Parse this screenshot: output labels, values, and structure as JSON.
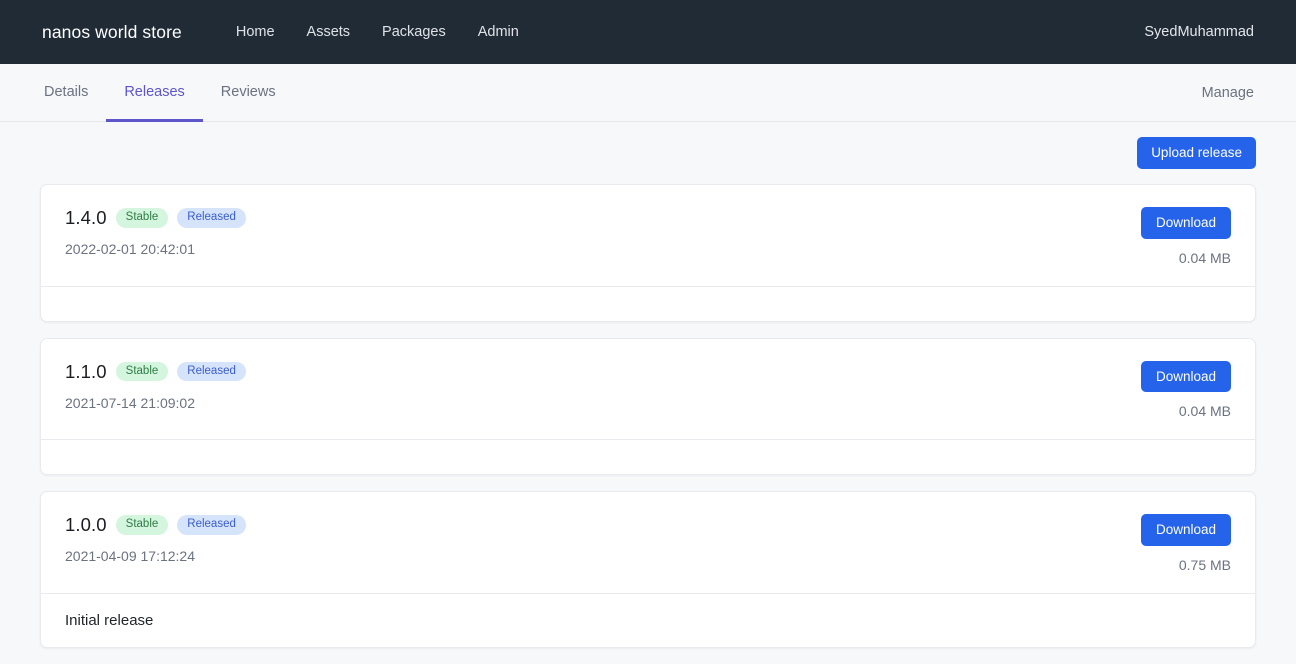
{
  "navbar": {
    "brand": "nanos world store",
    "links": [
      {
        "label": "Home"
      },
      {
        "label": "Assets"
      },
      {
        "label": "Packages"
      },
      {
        "label": "Admin"
      }
    ],
    "user": "SyedMuhammad"
  },
  "tabbar": {
    "tabs": [
      {
        "label": "Details",
        "active": false
      },
      {
        "label": "Releases",
        "active": true
      },
      {
        "label": "Reviews",
        "active": false
      }
    ],
    "manage_label": "Manage",
    "active_color": "#5d55c9"
  },
  "toolbar": {
    "upload_label": "Upload release",
    "accent_color": "#2563eb"
  },
  "releases": [
    {
      "version": "1.4.0",
      "badges": [
        {
          "label": "Stable",
          "type": "stable"
        },
        {
          "label": "Released",
          "type": "released"
        }
      ],
      "timestamp": "2022-02-01 20:42:01",
      "download_label": "Download",
      "filesize": "0.04 MB",
      "notes": ""
    },
    {
      "version": "1.1.0",
      "badges": [
        {
          "label": "Stable",
          "type": "stable"
        },
        {
          "label": "Released",
          "type": "released"
        }
      ],
      "timestamp": "2021-07-14 21:09:02",
      "download_label": "Download",
      "filesize": "0.04 MB",
      "notes": ""
    },
    {
      "version": "1.0.0",
      "badges": [
        {
          "label": "Stable",
          "type": "stable"
        },
        {
          "label": "Released",
          "type": "released"
        }
      ],
      "timestamp": "2021-04-09 17:12:24",
      "download_label": "Download",
      "filesize": "0.75 MB",
      "notes": "Initial release"
    }
  ],
  "colors": {
    "navbar_bg": "#212b36",
    "page_bg": "#f7f8fa",
    "badge_stable_bg": "#d4f5de",
    "badge_stable_fg": "#2f7d45",
    "badge_released_bg": "#d6e4fb",
    "badge_released_fg": "#3a5ccc"
  }
}
